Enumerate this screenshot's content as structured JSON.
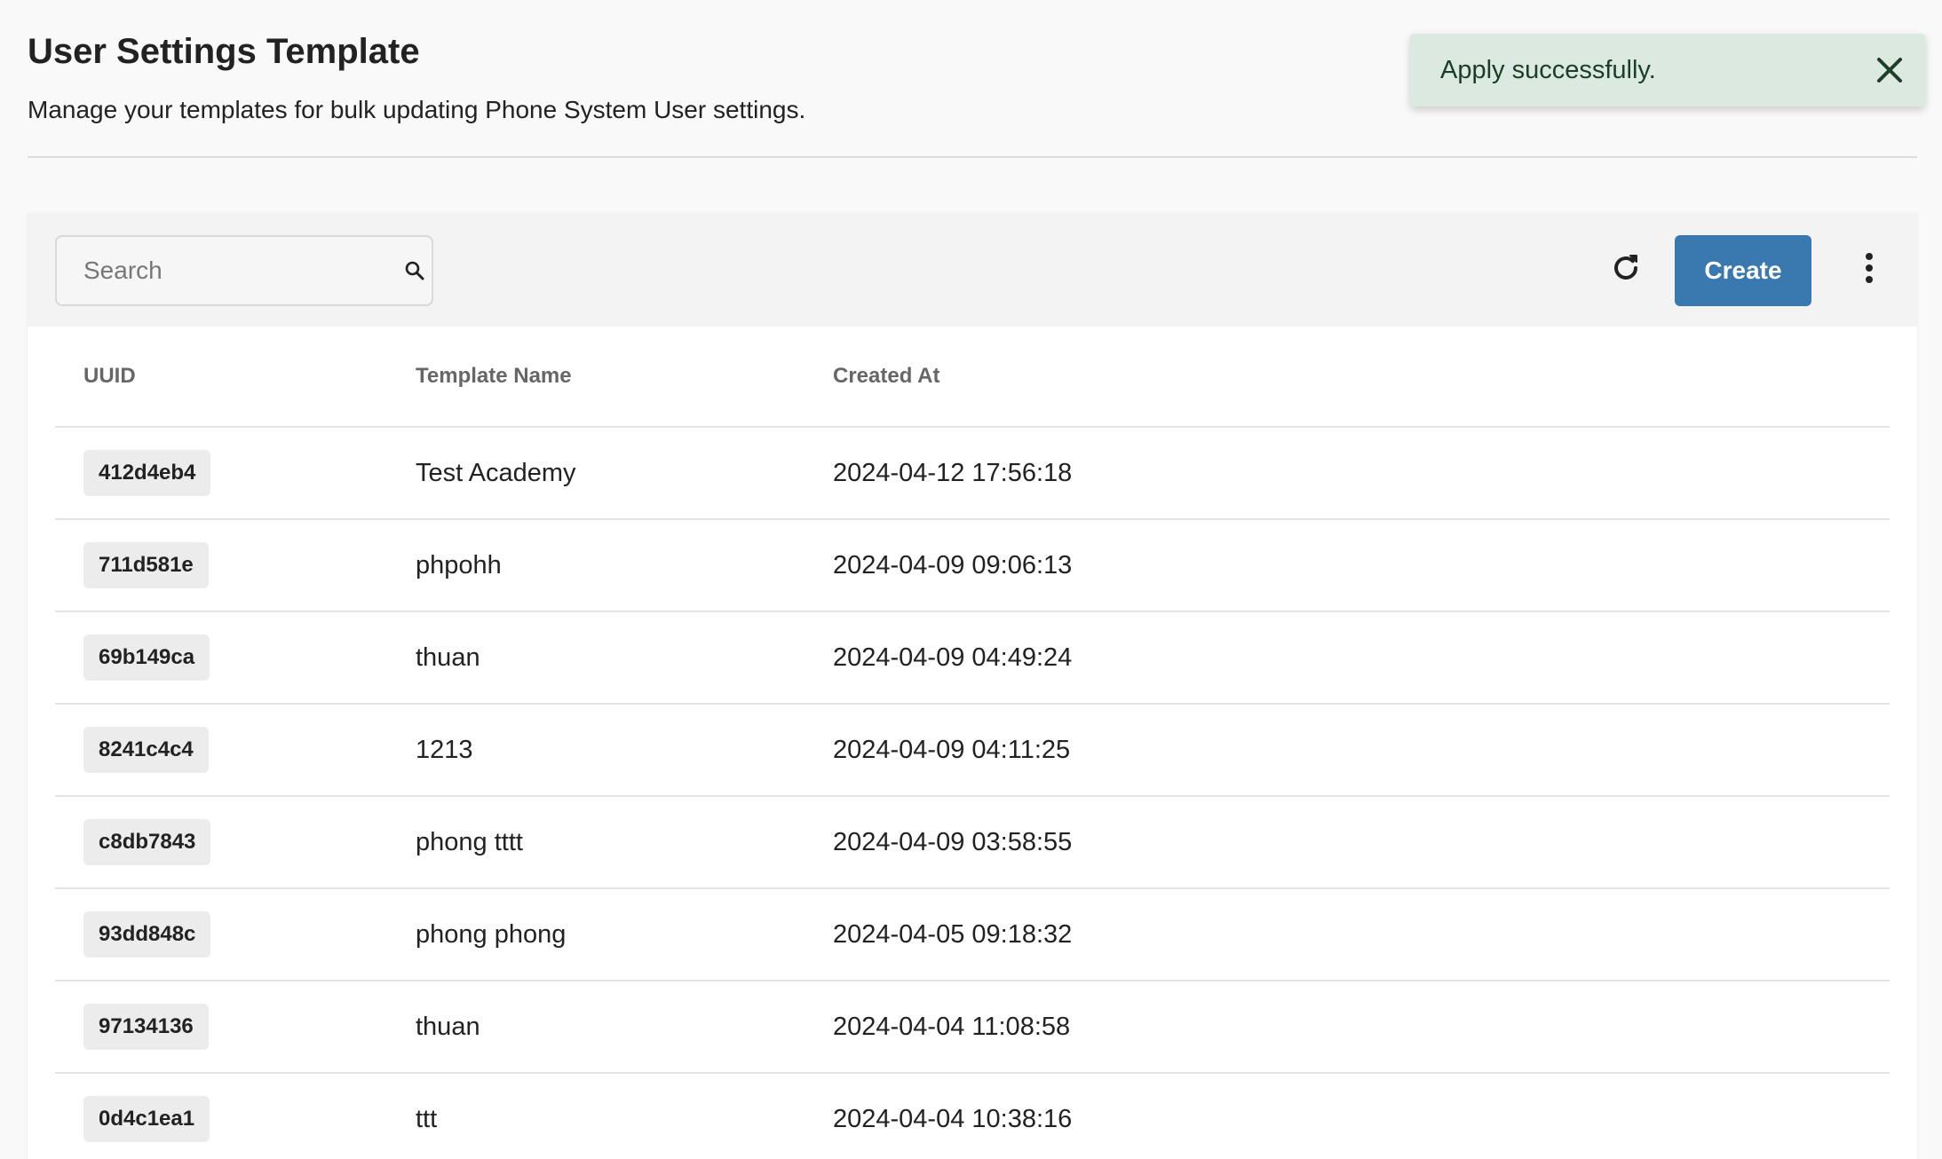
{
  "header": {
    "title": "User Settings Template",
    "subtitle": "Manage your templates for bulk updating Phone System User settings."
  },
  "toast": {
    "message": "Apply successfully.",
    "close_icon": "close-icon"
  },
  "toolbar": {
    "search_placeholder": "Search",
    "search_icon": "search-icon",
    "refresh_icon": "refresh-icon",
    "create_label": "Create",
    "more_icon": "more-vertical-icon"
  },
  "table": {
    "columns": [
      "UUID",
      "Template Name",
      "Created At"
    ],
    "rows": [
      {
        "uuid": "412d4eb4",
        "name": "Test Academy",
        "created_at": "2024-04-12 17:56:18"
      },
      {
        "uuid": "711d581e",
        "name": "phpohh",
        "created_at": "2024-04-09 09:06:13"
      },
      {
        "uuid": "69b149ca",
        "name": "thuan",
        "created_at": "2024-04-09 04:49:24"
      },
      {
        "uuid": "8241c4c4",
        "name": "1213",
        "created_at": "2024-04-09 04:11:25"
      },
      {
        "uuid": "c8db7843",
        "name": "phong tttt",
        "created_at": "2024-04-09 03:58:55"
      },
      {
        "uuid": "93dd848c",
        "name": "phong phong",
        "created_at": "2024-04-05 09:18:32"
      },
      {
        "uuid": "97134136",
        "name": "thuan",
        "created_at": "2024-04-04 11:08:58"
      },
      {
        "uuid": "0d4c1ea1",
        "name": "ttt",
        "created_at": "2024-04-04 10:38:16"
      }
    ]
  },
  "colors": {
    "primary": "#3a78b0",
    "toast_bg": "#dbe9e0",
    "page_bg": "#f9f9f9"
  }
}
